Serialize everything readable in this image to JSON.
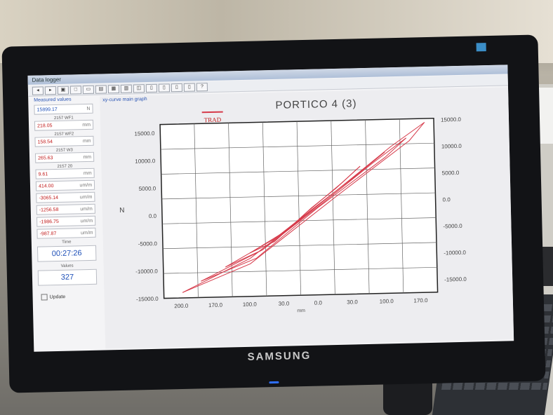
{
  "window": {
    "title": "Data logger"
  },
  "toolbar": {
    "buttons": [
      "◂",
      "▸",
      "▣",
      "□",
      "▭",
      "▤",
      "▦",
      "▥",
      "◫",
      "▯",
      "▯",
      "▯",
      "▯",
      "?"
    ]
  },
  "left_panel": {
    "header": "Measured values",
    "values": [
      {
        "value": "15899.17",
        "unit": "N"
      },
      {
        "value": "218.05",
        "unit": "mm"
      },
      {
        "value": "158.54",
        "unit": "mm"
      },
      {
        "value": "265.63",
        "unit": "mm"
      },
      {
        "value": "9.61",
        "unit": "mm"
      },
      {
        "value": "414.00",
        "unit": "um/m"
      },
      {
        "value": "-3065.14",
        "unit": "um/m"
      },
      {
        "value": "-1256.58",
        "unit": "um/m"
      },
      {
        "value": "-1986.75",
        "unit": "um/m"
      },
      {
        "value": "-987.87",
        "unit": "um/m"
      }
    ],
    "value_labels": [
      "2157 WF1",
      "2157 WF2",
      "2157 W3",
      "2157 20"
    ],
    "time_label": "Time",
    "time_value": "00:27:26",
    "count_label": "Values",
    "count_value": "327",
    "checkbox_label": "Update"
  },
  "graph": {
    "tab_label": "xy-curve main graph",
    "title": "PORTICO 4 (3)"
  },
  "monitor": {
    "brand": "SAMSUNG"
  },
  "chart_data": {
    "type": "line",
    "title": "PORTICO 4 (3)",
    "legend": [
      "TRAD"
    ],
    "xlabel": "mm",
    "ylabel": "N",
    "x_ticks": [
      "200.0",
      "170.0",
      "100.0",
      "30.0",
      "0.0",
      "30.0",
      "100.0",
      "170.0"
    ],
    "y_ticks_left": [
      "15000.0",
      "10000.0",
      "5000.0",
      "0.0",
      "-5000.0",
      "-10000.0",
      "-15000.0"
    ],
    "y_ticks_right": [
      "15000.0",
      "10000.0",
      "5000.0",
      "0.0",
      "-5000.0",
      "-10000.0",
      "-15000.0"
    ],
    "xlim": [
      -220,
      220
    ],
    "ylim": [
      -15000,
      17000
    ],
    "grid": true,
    "series": [
      {
        "name": "TRAD",
        "color": "#d63a4a",
        "loops": [
          {
            "up": [
              [
                -190,
                -14000
              ],
              [
                -80,
                -8000
              ],
              [
                60,
                4000
              ],
              [
                150,
                12000
              ],
              [
                205,
                16300
              ]
            ],
            "down": [
              [
                205,
                16300
              ],
              [
                180,
                13000
              ],
              [
                60,
                3000
              ],
              [
                -80,
                -9000
              ],
              [
                -190,
                -14000
              ]
            ]
          },
          {
            "up": [
              [
                -160,
                -12000
              ],
              [
                -60,
                -6500
              ],
              [
                40,
                2000
              ],
              [
                120,
                9000
              ],
              [
                175,
                13500
              ]
            ],
            "down": [
              [
                175,
                13500
              ],
              [
                140,
                10000
              ],
              [
                30,
                1000
              ],
              [
                -70,
                -8000
              ],
              [
                -160,
                -12000
              ]
            ]
          },
          {
            "up": [
              [
                -120,
                -9500
              ],
              [
                -40,
                -4500
              ],
              [
                30,
                1500
              ],
              [
                90,
                6500
              ],
              [
                140,
                11000
              ]
            ],
            "down": [
              [
                140,
                11000
              ],
              [
                100,
                7500
              ],
              [
                20,
                500
              ],
              [
                -60,
                -6500
              ],
              [
                -120,
                -9500
              ]
            ]
          },
          {
            "up": [
              [
                -80,
                -7000
              ],
              [
                -20,
                -3000
              ],
              [
                20,
                1000
              ],
              [
                60,
                4500
              ],
              [
                100,
                8500
              ]
            ],
            "down": [
              [
                100,
                8500
              ],
              [
                70,
                5500
              ],
              [
                10,
                0
              ],
              [
                -40,
                -5000
              ],
              [
                -80,
                -7000
              ]
            ]
          }
        ]
      }
    ]
  }
}
